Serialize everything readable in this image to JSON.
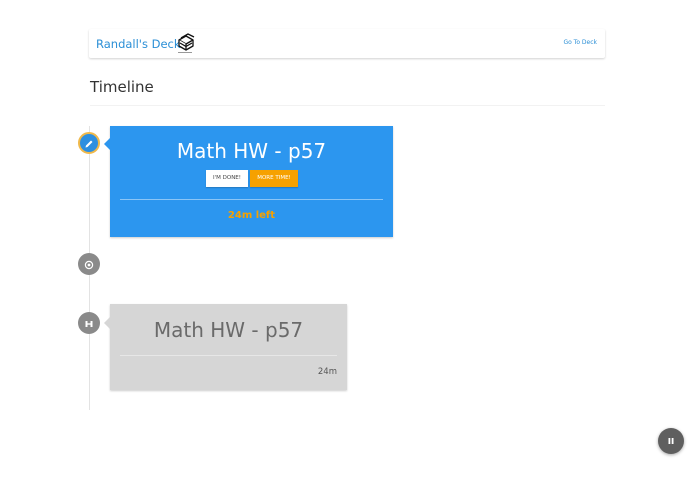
{
  "header": {
    "deck_title": "Randall's Deck",
    "deck_icon": "stacked-cards-icon",
    "goto_link": "Go To Deck"
  },
  "section": {
    "title": "Timeline"
  },
  "timeline": {
    "active_task": {
      "title": "Math HW - p57",
      "done_label": "I'M DONE!",
      "more_time_label": "MORE TIME!",
      "time_left": "24m left",
      "icon": "pencil-icon"
    },
    "pending_node": {
      "icon": "target-icon"
    },
    "completed_task": {
      "title": "Math HW - p57",
      "duration": "24m",
      "icon": "barbell-icon"
    }
  },
  "fab": {
    "icon": "pause-icon"
  },
  "colors": {
    "primary": "#2c96ef",
    "accent": "#f6a100",
    "node_grey": "#8a8a8a",
    "card_grey": "#d6d6d6"
  }
}
